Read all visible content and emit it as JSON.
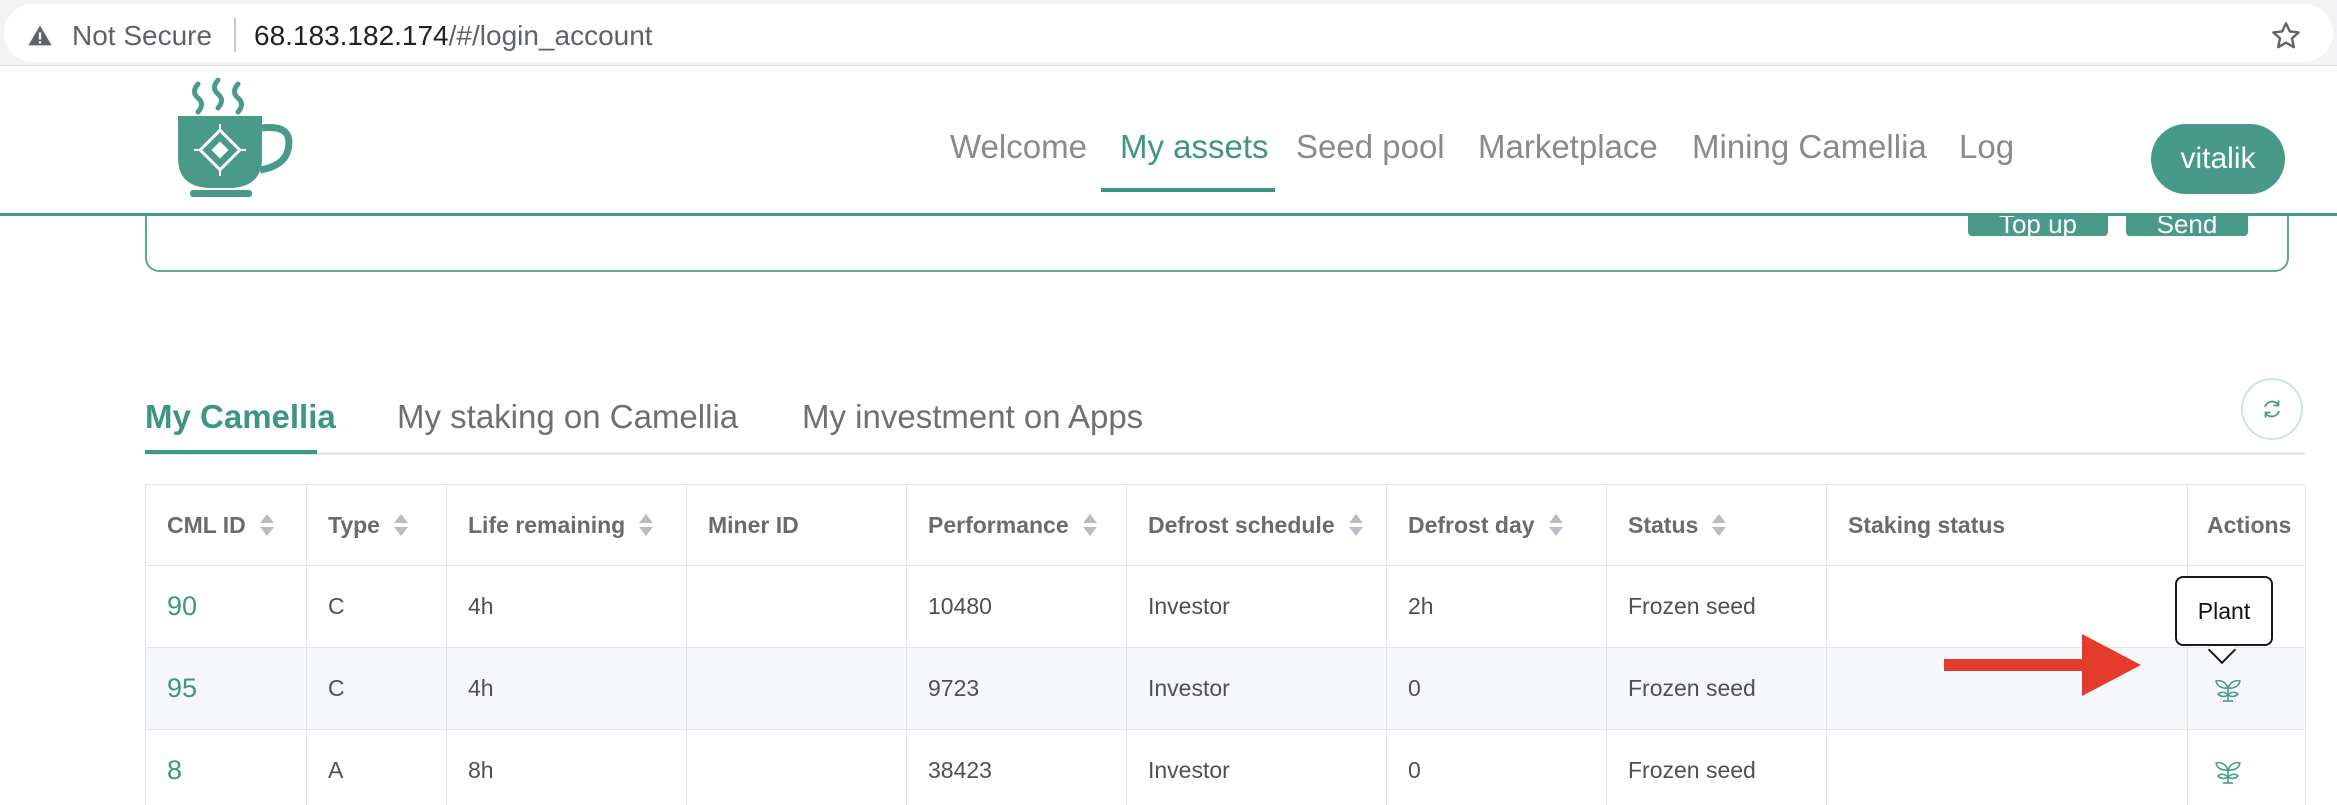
{
  "browser": {
    "security_label": "Not Secure",
    "url_host": "68.183.182.174",
    "url_path": "/#/login_account"
  },
  "header": {
    "nav": [
      {
        "label": "Welcome",
        "active": false
      },
      {
        "label": "My assets",
        "active": true
      },
      {
        "label": "Seed pool",
        "active": false
      },
      {
        "label": "Marketplace",
        "active": false
      },
      {
        "label": "Mining Camellia",
        "active": false
      },
      {
        "label": "Log",
        "active": false
      }
    ],
    "user_label": "vitalik"
  },
  "wallet_card": {
    "buttons": [
      "Top up",
      "Send"
    ]
  },
  "tabs": [
    {
      "label": "My Camellia",
      "active": true
    },
    {
      "label": "My staking on Camellia",
      "active": false
    },
    {
      "label": "My investment on Apps",
      "active": false
    }
  ],
  "table": {
    "columns": [
      "CML ID",
      "Type",
      "Life remaining",
      "Miner ID",
      "Performance",
      "Defrost schedule",
      "Defrost day",
      "Status",
      "Staking status",
      "Actions"
    ],
    "sortable": [
      true,
      true,
      true,
      false,
      true,
      true,
      true,
      true,
      false,
      false
    ],
    "rows": [
      {
        "cml_id": "90",
        "type": "C",
        "life_remaining": "4h",
        "miner_id": "",
        "performance": "10480",
        "defrost_schedule": "Investor",
        "defrost_day": "2h",
        "status": "Frozen seed",
        "staking_status": ""
      },
      {
        "cml_id": "95",
        "type": "C",
        "life_remaining": "4h",
        "miner_id": "",
        "performance": "9723",
        "defrost_schedule": "Investor",
        "defrost_day": "0",
        "status": "Frozen seed",
        "staking_status": ""
      },
      {
        "cml_id": "8",
        "type": "A",
        "life_remaining": "8h",
        "miner_id": "",
        "performance": "38423",
        "defrost_schedule": "Investor",
        "defrost_day": "0",
        "status": "Frozen seed",
        "staking_status": ""
      }
    ],
    "action_icon": "plant-icon"
  },
  "tooltip": {
    "text": "Plant"
  },
  "colors": {
    "accent": "#3e9581",
    "button": "#47998a",
    "annotation_arrow": "#e53b2c"
  }
}
